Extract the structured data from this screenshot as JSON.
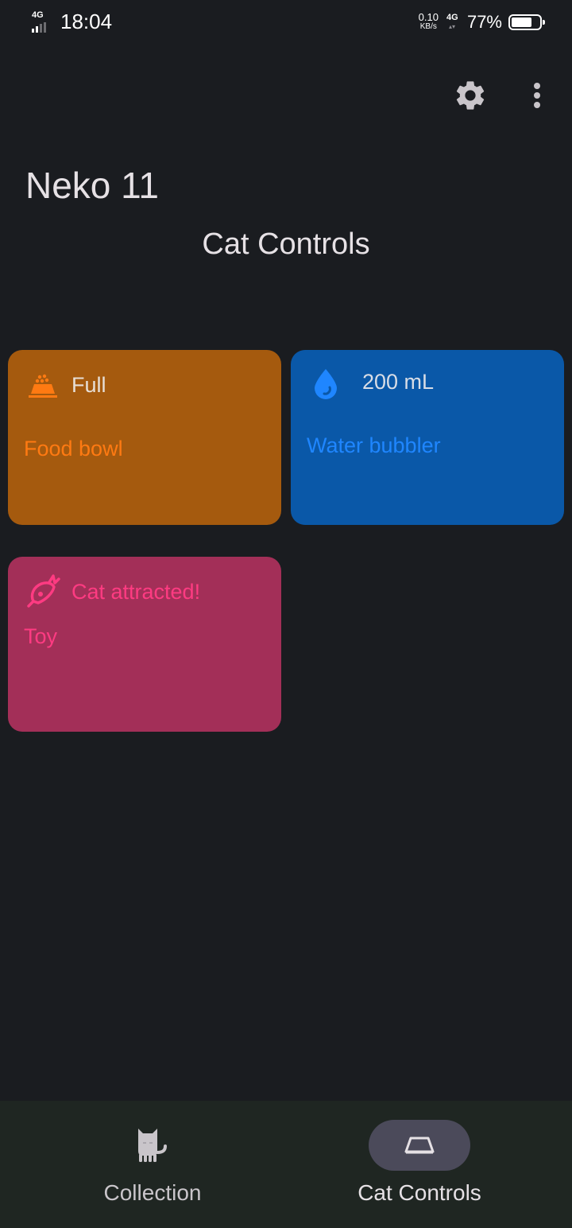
{
  "status_bar": {
    "network_left": "4G",
    "time": "18:04",
    "speed_value": "0.10",
    "speed_unit": "KB/s",
    "network_right": "4G",
    "battery_percent": "77%",
    "battery_level": 0.77
  },
  "app_bar": {
    "settings_icon": "gear-icon",
    "menu_icon": "more-vert-icon"
  },
  "app_title": "Neko 11",
  "page_title": "Cat Controls",
  "tiles": [
    {
      "icon": "food-bowl-icon",
      "status": "Full",
      "name": "Food bowl",
      "background": "#a55a0e",
      "accent": "#ff7a12",
      "status_color": "#e7dfd7"
    },
    {
      "icon": "water-drop-icon",
      "status": "200 mL",
      "name": "Water bubbler",
      "background": "#0a58a8",
      "accent": "#1f86ff",
      "status_color": "#d8dde6"
    },
    {
      "icon": "fish-toy-icon",
      "status": "Cat attracted!",
      "name": "Toy",
      "background": "#a32f58",
      "accent": "#ff3b82",
      "status_color": "#ff3b82"
    }
  ],
  "bottom_nav": {
    "items": [
      {
        "label": "Collection",
        "icon": "cat-icon",
        "selected": false
      },
      {
        "label": "Cat Controls",
        "icon": "food-bowl-outline-icon",
        "selected": true
      }
    ]
  }
}
